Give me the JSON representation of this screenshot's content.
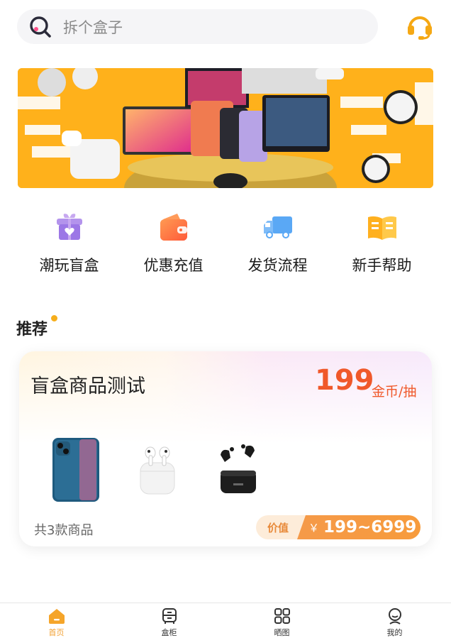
{
  "search": {
    "placeholder": "拆个盒子"
  },
  "quick_nav": [
    {
      "label": "潮玩盲盒",
      "icon": "gift-box-icon"
    },
    {
      "label": "优惠充值",
      "icon": "wallet-icon"
    },
    {
      "label": "发货流程",
      "icon": "truck-icon"
    },
    {
      "label": "新手帮助",
      "icon": "book-icon"
    }
  ],
  "section": {
    "title": "推荐"
  },
  "card": {
    "title": "盲盒商品测试",
    "price": "199",
    "price_unit": "金币/抽",
    "count_text": "共3款商品",
    "value_label": "价值",
    "currency": "￥",
    "value_range": "199~6999",
    "products": [
      "iphone-image",
      "airpods-image",
      "earbuds-image"
    ]
  },
  "tabs": [
    {
      "label": "首页",
      "icon": "home-icon",
      "active": true
    },
    {
      "label": "盒柜",
      "icon": "cabinet-icon",
      "active": false
    },
    {
      "label": "晒图",
      "icon": "grid-icon",
      "active": false
    },
    {
      "label": "我的",
      "icon": "profile-icon",
      "active": false
    }
  ],
  "colors": {
    "accent": "#f6ae1b",
    "price": "#f0582a",
    "tab_active": "#f2a134"
  }
}
